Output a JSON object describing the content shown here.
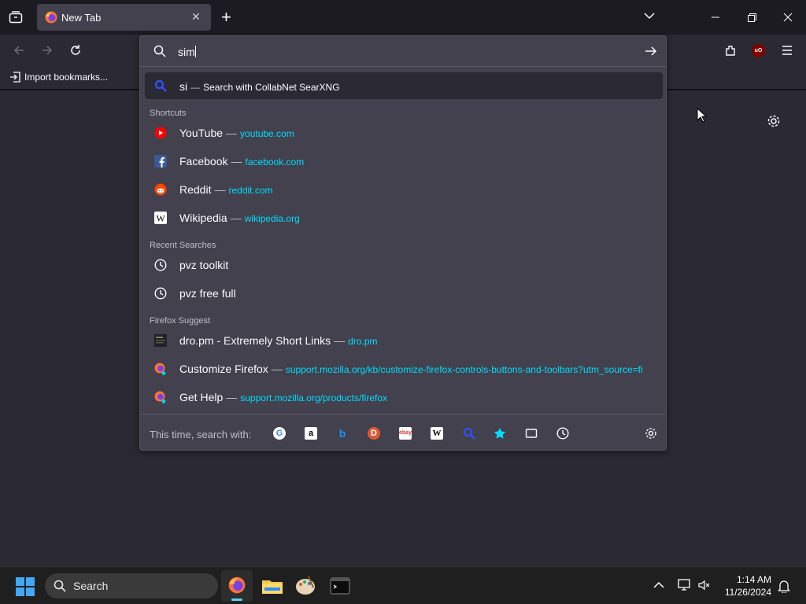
{
  "tab": {
    "title": "New Tab",
    "close": "✕"
  },
  "toolbar": {
    "new_tab": "+",
    "list_all_tabs": "⌄"
  },
  "bookmarks_bar": {
    "import_label": "Import bookmarks..."
  },
  "urlbar": {
    "input_value": "sim",
    "selected": {
      "query": "si",
      "sep": "—",
      "text": "Search with CollabNet SearXNG"
    },
    "groups": {
      "shortcuts": "Shortcuts",
      "recent": "Recent Searches",
      "suggest": "Firefox Suggest"
    },
    "shortcuts": [
      {
        "title": "YouTube",
        "url": "youtube.com",
        "icon": "youtube-icon"
      },
      {
        "title": "Facebook",
        "url": "facebook.com",
        "icon": "facebook-icon"
      },
      {
        "title": "Reddit",
        "url": "reddit.com",
        "icon": "reddit-icon"
      },
      {
        "title": "Wikipedia",
        "url": "wikipedia.org",
        "icon": "wikipedia-icon"
      }
    ],
    "recent": [
      {
        "title": "pvz toolkit"
      },
      {
        "title": "pvz free full"
      }
    ],
    "suggest": [
      {
        "title": "dro.pm - Extremely Short Links",
        "url": "dro.pm"
      },
      {
        "title": "Customize Firefox",
        "url": "support.mozilla.org/kb/customize-firefox-controls-buttons-and-toolbars?utm_source=fi"
      },
      {
        "title": "Get Help",
        "url": "support.mozilla.org/products/firefox"
      }
    ],
    "one_off_label": "This time, search with:"
  },
  "taskbar": {
    "search_label": "Search",
    "time": "1:14 AM",
    "date": "11/26/2024"
  },
  "colors": {
    "accent": "#00ddff",
    "panel": "#42414d",
    "chrome": "#2b2a33"
  }
}
